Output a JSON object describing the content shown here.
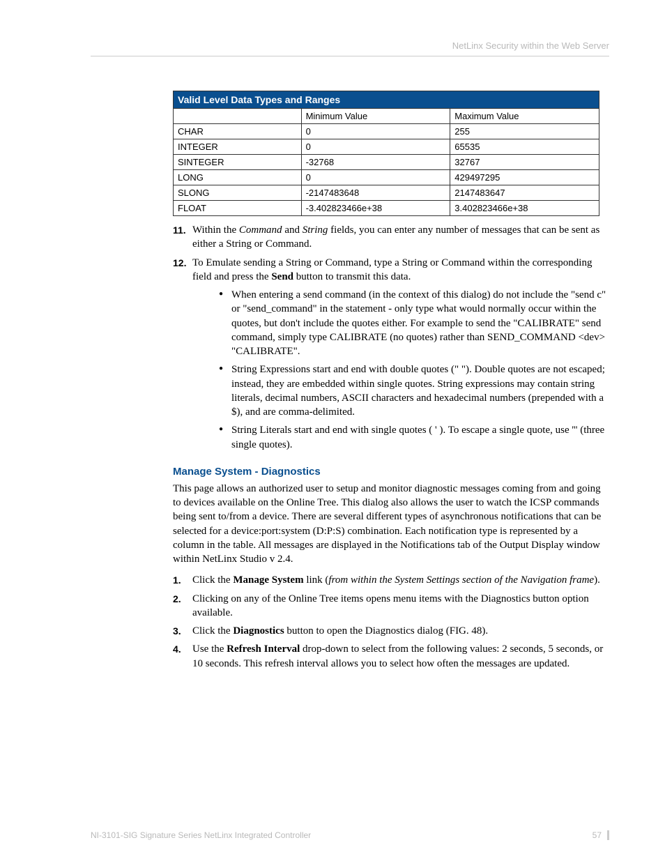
{
  "header": {
    "right": "NetLinx Security within the Web Server"
  },
  "table": {
    "title": "Valid Level Data Types and Ranges",
    "headers": [
      "",
      "Minimum Value",
      "Maximum Value"
    ],
    "rows": [
      [
        "CHAR",
        "0",
        "255"
      ],
      [
        "INTEGER",
        "0",
        "65535"
      ],
      [
        "SINTEGER",
        "-32768",
        "32767"
      ],
      [
        "LONG",
        "0",
        "429497295"
      ],
      [
        "SLONG",
        "-2147483648",
        "2147483647"
      ],
      [
        "FLOAT",
        "-3.402823466e+38",
        "3.402823466e+38"
      ]
    ]
  },
  "step11": {
    "num": "11.",
    "t1": "Within the ",
    "i1": "Command",
    "t2": " and ",
    "i2": "String",
    "t3": " fields, you can enter any number of messages that can be sent as either a String or Command."
  },
  "step12": {
    "num": "12.",
    "t1": "To Emulate sending a String or Command, type a String or Command within the corresponding field and press the ",
    "b1": "Send",
    "t2": " button to transmit this data.",
    "bullets": [
      "When entering a send command (in the context of this dialog) do not include the \"send c\" or \"send_command\" in the statement - only type what would normally occur within the quotes, but don't include the quotes either. For example to send the \"CALIBRATE\" send command, simply type CALIBRATE (no quotes) rather than SEND_COMMAND <dev> \"CALIBRATE\".",
      "String Expressions start and end with double quotes (\" \"). Double quotes are not escaped; instead, they are embedded within single quotes. String expressions may contain string literals, decimal numbers, ASCII characters and hexadecimal numbers (prepended with a $), and are comma-delimited.",
      "String Literals start and end with single quotes ( ' ). To escape a single quote, use ''' (three single quotes)."
    ]
  },
  "section": {
    "heading": "Manage System - Diagnostics",
    "para": "This page allows an authorized user to setup and monitor diagnostic messages coming from and going to devices available on the Online Tree. This dialog also allows the user to watch the ICSP commands being sent to/from a device. There are several different types of asynchronous notifications that can be selected for a device:port:system (D:P:S) combination. Each notification type is represented by a column in the table. All messages are displayed in the Notifications tab of the Output Display window within NetLinx Studio v 2.4."
  },
  "steps": {
    "s1": {
      "num": "1.",
      "t1": "Click the ",
      "b1": "Manage System",
      "t2": " link (",
      "i1": "from within the System Settings section of the Navigation frame",
      "t3": ")."
    },
    "s2": {
      "num": "2.",
      "t1": "Clicking on any of the Online Tree items opens menu items with the Diagnostics button option available."
    },
    "s3": {
      "num": "3.",
      "t1": "Click the ",
      "b1": "Diagnostics",
      "t2": " button to open the Diagnostics dialog (FIG. 48)."
    },
    "s4": {
      "num": "4.",
      "t1": "Use the ",
      "b1": "Refresh Interval",
      "t2": " drop-down to select from the following values: 2 seconds, 5 seconds, or 10 seconds. This refresh interval allows you to select how often the messages are updated."
    }
  },
  "footer": {
    "left": "NI-3101-SIG Signature Series NetLinx Integrated Controller",
    "page": "57"
  }
}
